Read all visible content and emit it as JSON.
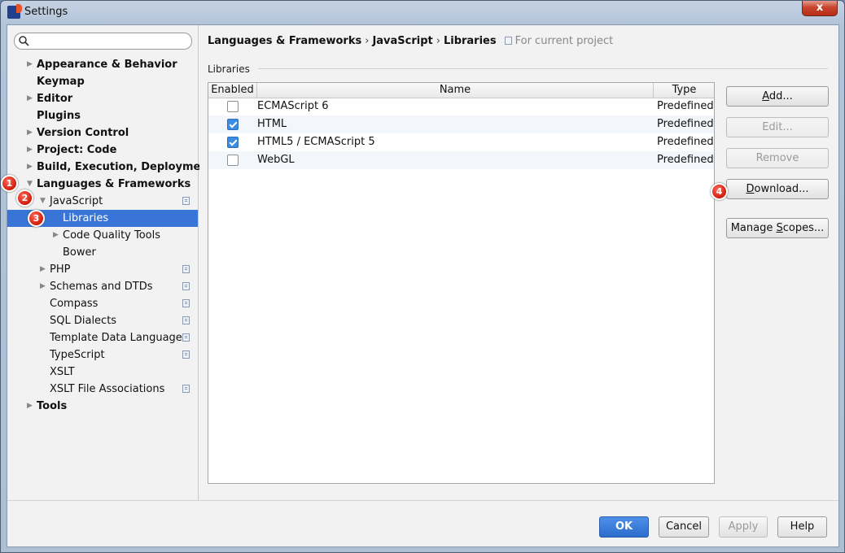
{
  "window": {
    "title": "Settings",
    "close_label": "x"
  },
  "search": {
    "placeholder": ""
  },
  "tree": [
    {
      "label": "Appearance & Behavior",
      "bold": true,
      "arrow": true,
      "indent": 0
    },
    {
      "label": "Keymap",
      "bold": true,
      "arrow": false,
      "indent": 0
    },
    {
      "label": "Editor",
      "bold": true,
      "arrow": true,
      "indent": 0
    },
    {
      "label": "Plugins",
      "bold": true,
      "arrow": false,
      "indent": 0
    },
    {
      "label": "Version Control",
      "bold": true,
      "arrow": true,
      "indent": 0
    },
    {
      "label": "Project: Code",
      "bold": true,
      "arrow": true,
      "indent": 0
    },
    {
      "label": "Build, Execution, Deployment",
      "bold": true,
      "arrow": true,
      "indent": 0
    },
    {
      "label": "Languages & Frameworks",
      "bold": true,
      "arrow": true,
      "expanded": true,
      "indent": 0
    },
    {
      "label": "JavaScript",
      "bold": false,
      "arrow": true,
      "expanded": true,
      "indent": 1,
      "project": true
    },
    {
      "label": "Libraries",
      "bold": false,
      "arrow": false,
      "indent": 2,
      "selected": true
    },
    {
      "label": "Code Quality Tools",
      "bold": false,
      "arrow": true,
      "indent": 2
    },
    {
      "label": "Bower",
      "bold": false,
      "arrow": false,
      "indent": 2
    },
    {
      "label": "PHP",
      "bold": false,
      "arrow": true,
      "indent": 1,
      "project": true
    },
    {
      "label": "Schemas and DTDs",
      "bold": false,
      "arrow": true,
      "indent": 1,
      "project": true
    },
    {
      "label": "Compass",
      "bold": false,
      "arrow": false,
      "indent": 1,
      "project": true
    },
    {
      "label": "SQL Dialects",
      "bold": false,
      "arrow": false,
      "indent": 1,
      "project": true
    },
    {
      "label": "Template Data Languages",
      "bold": false,
      "arrow": false,
      "indent": 1,
      "project": true
    },
    {
      "label": "TypeScript",
      "bold": false,
      "arrow": false,
      "indent": 1,
      "project": true
    },
    {
      "label": "XSLT",
      "bold": false,
      "arrow": false,
      "indent": 1
    },
    {
      "label": "XSLT File Associations",
      "bold": false,
      "arrow": false,
      "indent": 1,
      "project": true
    },
    {
      "label": "Tools",
      "bold": true,
      "arrow": true,
      "indent": 0
    }
  ],
  "badges": [
    "1",
    "2",
    "3",
    "4"
  ],
  "breadcrumb": {
    "part1": "Languages & Frameworks",
    "part2": "JavaScript",
    "part3": "Libraries",
    "separator": "›",
    "note": "For current project"
  },
  "section_label": "Libraries",
  "table": {
    "headers": [
      "Enabled",
      "Name",
      "Type"
    ],
    "rows": [
      {
        "enabled": false,
        "name": "ECMAScript 6",
        "type": "Predefined"
      },
      {
        "enabled": true,
        "name": "HTML",
        "type": "Predefined"
      },
      {
        "enabled": true,
        "name": "HTML5 / ECMAScript 5",
        "type": "Predefined"
      },
      {
        "enabled": false,
        "name": "WebGL",
        "type": "Predefined"
      }
    ]
  },
  "buttons": {
    "add": {
      "mnemonic": "A",
      "rest": "dd..."
    },
    "edit": "Edit...",
    "remove": "Remove",
    "download": {
      "mnemonic": "D",
      "rest": "ownload..."
    },
    "manage": {
      "pre": "Manage ",
      "mnemonic": "S",
      "rest": "copes..."
    }
  },
  "footer": {
    "ok": "OK",
    "cancel": "Cancel",
    "apply": "Apply",
    "help": "Help"
  },
  "colors": {
    "selection": "#3875d7",
    "primary": "#3a7ddc",
    "badge": "#e02515"
  }
}
